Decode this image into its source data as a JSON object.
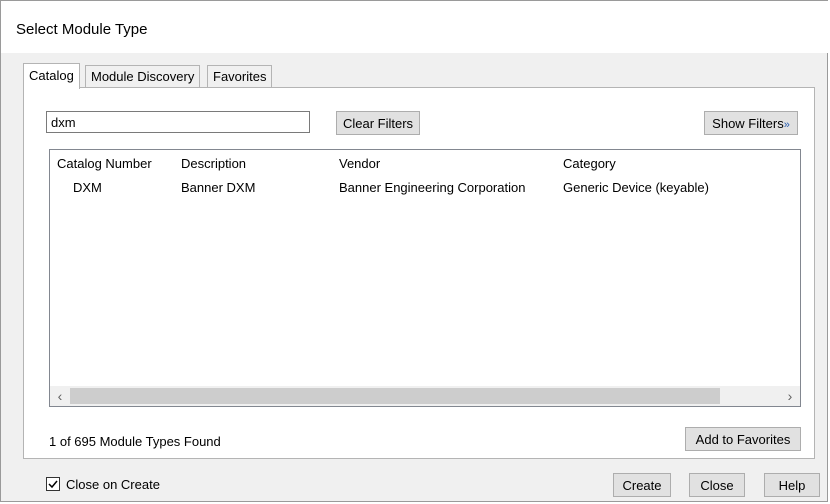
{
  "window": {
    "title": "Select Module Type"
  },
  "tabs": [
    {
      "label": "Catalog"
    },
    {
      "label": "Module Discovery"
    },
    {
      "label": "Favorites"
    }
  ],
  "search": {
    "value": "dxm"
  },
  "buttons": {
    "clear_filters": "Clear Filters",
    "show_filters": "Show Filters",
    "add_to_favorites": "Add to Favorites",
    "create": "Create",
    "close": "Close",
    "help": "Help"
  },
  "table": {
    "columns": [
      "Catalog Number",
      "Description",
      "Vendor",
      "Category"
    ],
    "rows": [
      [
        "DXM",
        "Banner DXM",
        "Banner Engineering Corporation",
        "Generic Device (keyable)"
      ]
    ]
  },
  "status": {
    "text": "1 of 695 Module Types Found"
  },
  "footer": {
    "close_on_create_label": "Close on Create",
    "close_on_create_checked": true
  }
}
